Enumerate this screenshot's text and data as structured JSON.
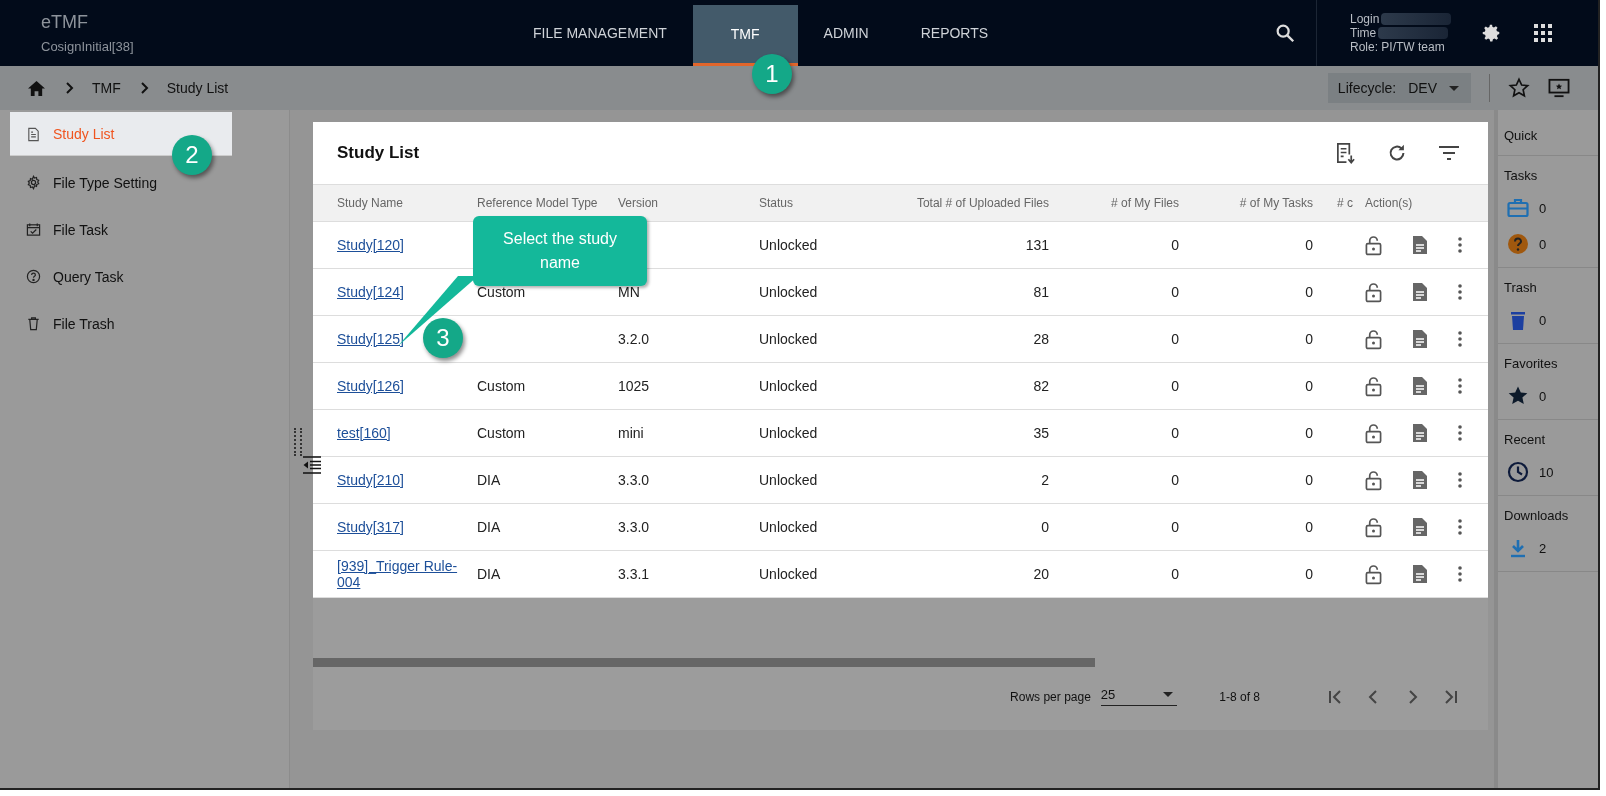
{
  "app": {
    "name": "eTMF",
    "subtitle": "CosignInitial[38]"
  },
  "nav_tabs": [
    {
      "label": "FILE MANAGEMENT",
      "selected": false
    },
    {
      "label": "TMF",
      "selected": true
    },
    {
      "label": "ADMIN",
      "selected": false
    },
    {
      "label": "REPORTS",
      "selected": false
    }
  ],
  "user": {
    "login_label": "Login",
    "time_label": "Time",
    "role": "Role: PI/TW team"
  },
  "breadcrumb": [
    "TMF",
    "Study List"
  ],
  "lifecycle": {
    "label": "Lifecycle:",
    "value": "DEV"
  },
  "sidebar": {
    "items": [
      {
        "label": "Study List",
        "kind": "list",
        "selected": true
      },
      {
        "label": "File Type Setting",
        "kind": "settings",
        "selected": false
      },
      {
        "label": "File Task",
        "kind": "task",
        "selected": false
      },
      {
        "label": "Query Task",
        "kind": "query",
        "selected": false
      },
      {
        "label": "File Trash",
        "kind": "trash",
        "selected": false
      }
    ]
  },
  "card": {
    "title": "Study List",
    "columns": [
      "Study Name",
      "Reference Model Type",
      "Version",
      "Status",
      "Total # of Uploaded Files",
      "# of My Files",
      "# of My Tasks",
      "# c",
      "Action(s)"
    ],
    "rows": [
      {
        "study_name": "Study[120]",
        "reference_model_type": "",
        "version": "",
        "status": "Unlocked",
        "total_uploaded": "131",
        "my_files": "0",
        "my_tasks": "0"
      },
      {
        "study_name": "Study[124]",
        "reference_model_type": "Custom",
        "version": "MN",
        "status": "Unlocked",
        "total_uploaded": "81",
        "my_files": "0",
        "my_tasks": "0"
      },
      {
        "study_name": "Study[125]",
        "reference_model_type": "",
        "version": "3.2.0",
        "status": "Unlocked",
        "total_uploaded": "28",
        "my_files": "0",
        "my_tasks": "0"
      },
      {
        "study_name": "Study[126]",
        "reference_model_type": "Custom",
        "version": "1025",
        "status": "Unlocked",
        "total_uploaded": "82",
        "my_files": "0",
        "my_tasks": "0"
      },
      {
        "study_name": "test[160]",
        "reference_model_type": "Custom",
        "version": "mini",
        "status": "Unlocked",
        "total_uploaded": "35",
        "my_files": "0",
        "my_tasks": "0"
      },
      {
        "study_name": "Study[210]",
        "reference_model_type": "DIA",
        "version": "3.3.0",
        "status": "Unlocked",
        "total_uploaded": "2",
        "my_files": "0",
        "my_tasks": "0"
      },
      {
        "study_name": "Study[317]",
        "reference_model_type": "DIA",
        "version": "3.3.0",
        "status": "Unlocked",
        "total_uploaded": "0",
        "my_files": "0",
        "my_tasks": "0"
      },
      {
        "study_name": "[939]_Trigger Rule-004",
        "reference_model_type": "DIA",
        "version": "3.3.1",
        "status": "Unlocked",
        "total_uploaded": "20",
        "my_files": "0",
        "my_tasks": "0"
      }
    ]
  },
  "pagination": {
    "rows_per_page_label": "Rows per page",
    "rows_per_page": "25",
    "range": "1-8 of 8"
  },
  "quick_panel": {
    "title": "Quick",
    "sections": [
      {
        "title": "Tasks",
        "items": [
          {
            "kind": "tasks",
            "count": "0"
          },
          {
            "kind": "query",
            "count": "0"
          }
        ]
      },
      {
        "title": "Trash",
        "items": [
          {
            "kind": "trash",
            "count": "0"
          }
        ]
      },
      {
        "title": "Favorites",
        "items": [
          {
            "kind": "star",
            "count": "0"
          }
        ]
      },
      {
        "title": "Recent",
        "items": [
          {
            "kind": "recent",
            "count": "10"
          }
        ]
      },
      {
        "title": "Downloads",
        "items": [
          {
            "kind": "download",
            "count": "2"
          }
        ]
      }
    ]
  },
  "callouts": [
    {
      "number": "1"
    },
    {
      "number": "2"
    },
    {
      "number": "3",
      "text": "Select the study name"
    }
  ]
}
